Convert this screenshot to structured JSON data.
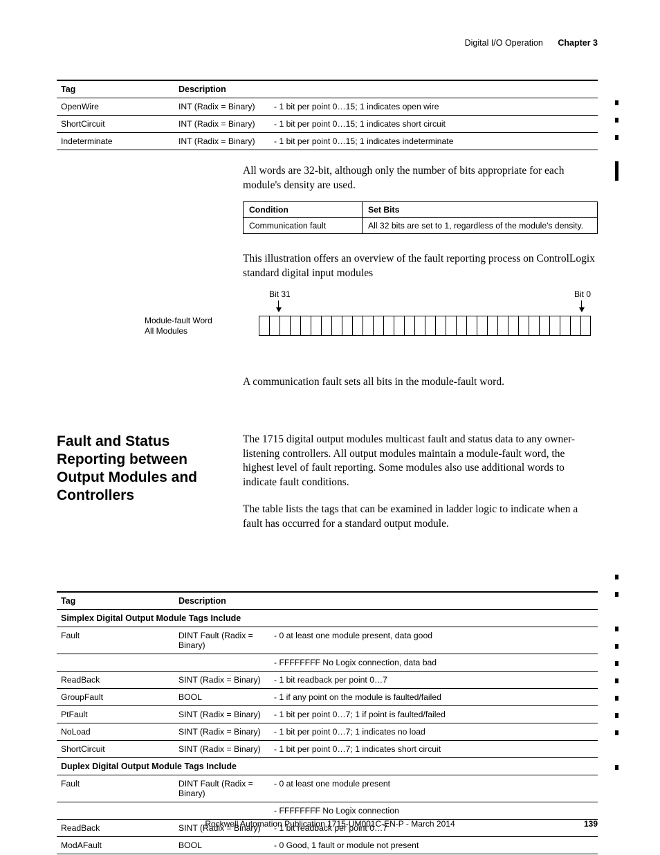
{
  "header": {
    "section": "Digital I/O Operation",
    "chapter": "Chapter 3"
  },
  "table1": {
    "headers": {
      "tag": "Tag",
      "desc": "Description"
    },
    "rows": [
      {
        "tag": "OpenWire",
        "type": "INT (Radix = Binary)",
        "desc": "- 1 bit per point 0…15; 1 indicates open wire"
      },
      {
        "tag": "ShortCircuit",
        "type": "INT (Radix = Binary)",
        "desc": "- 1 bit per point 0…15; 1 indicates short circuit"
      },
      {
        "tag": "Indeterminate",
        "type": "INT (Radix = Binary)",
        "desc": "- 1 bit per point 0…15; 1 indicates indeterminate"
      }
    ]
  },
  "para1": "All words are 32-bit, although only the number of bits appropriate for each module's density are used.",
  "condTable": {
    "headers": {
      "cond": "Condition",
      "bits": "Set Bits"
    },
    "row": {
      "cond": "Communication fault",
      "bits": "All 32 bits are set to 1, regardless of the module's density."
    }
  },
  "para2": "This illustration offers an overview of the fault reporting process on ControlLogix standard digital input modules",
  "illus": {
    "bit31": "Bit 31",
    "bit0": "Bit 0",
    "moduleWord": "Module-fault Word",
    "allModules": "All Modules"
  },
  "para3": "A communication fault sets all bits in the module-fault word.",
  "section": {
    "heading": "Fault and Status Reporting between Output Modules and Controllers",
    "p1": "The 1715 digital output modules multicast fault and status data to any owner-listening controllers. All output modules maintain a module-fault word, the highest level of fault reporting. Some modules also use additional words to indicate fault conditions.",
    "p2": "The table lists the tags that can be examined in ladder logic to indicate when a fault has occurred for a standard output module."
  },
  "table2": {
    "headers": {
      "tag": "Tag",
      "desc": "Description"
    },
    "sub1": "Simplex Digital Output Module Tags Include",
    "rows1": [
      {
        "tag": "Fault",
        "type": "DINT Fault (Radix = Binary)",
        "desc": "- 0 at least one module present, data good"
      },
      {
        "tag": "",
        "type": "",
        "desc": "- FFFFFFFF No Logix connection, data bad"
      },
      {
        "tag": "ReadBack",
        "type": "SINT (Radix = Binary)",
        "desc": "- 1 bit readback per point 0…7"
      },
      {
        "tag": "GroupFault",
        "type": "BOOL",
        "desc": "- 1 if any point on the module is faulted/failed"
      },
      {
        "tag": "PtFault",
        "type": "SINT (Radix = Binary)",
        "desc": "- 1 bit per point 0…7; 1 if point is faulted/failed"
      },
      {
        "tag": "NoLoad",
        "type": "SINT (Radix = Binary)",
        "desc": "- 1 bit per point 0…7; 1 indicates no load"
      },
      {
        "tag": "ShortCircuit",
        "type": "SINT (Radix = Binary)",
        "desc": "- 1 bit per point 0…7; 1 indicates short circuit"
      }
    ],
    "sub2": "Duplex Digital Output Module Tags Include",
    "rows2": [
      {
        "tag": "Fault",
        "type": "DINT Fault (Radix = Binary)",
        "desc": "- 0 at least one module present"
      },
      {
        "tag": "",
        "type": "",
        "desc": "- FFFFFFFF No Logix connection"
      },
      {
        "tag": "ReadBack",
        "type": "SINT (Radix = Binary)",
        "desc": "- 1 bit readback per point 0…7"
      },
      {
        "tag": "ModAFault",
        "type": "BOOL",
        "desc": "- 0 Good, 1 fault or module not present"
      }
    ]
  },
  "footer": {
    "pubLine": "Rockwell Automation Publication 1715-UM001C-EN-P - March 2014",
    "pageNum": "139"
  }
}
